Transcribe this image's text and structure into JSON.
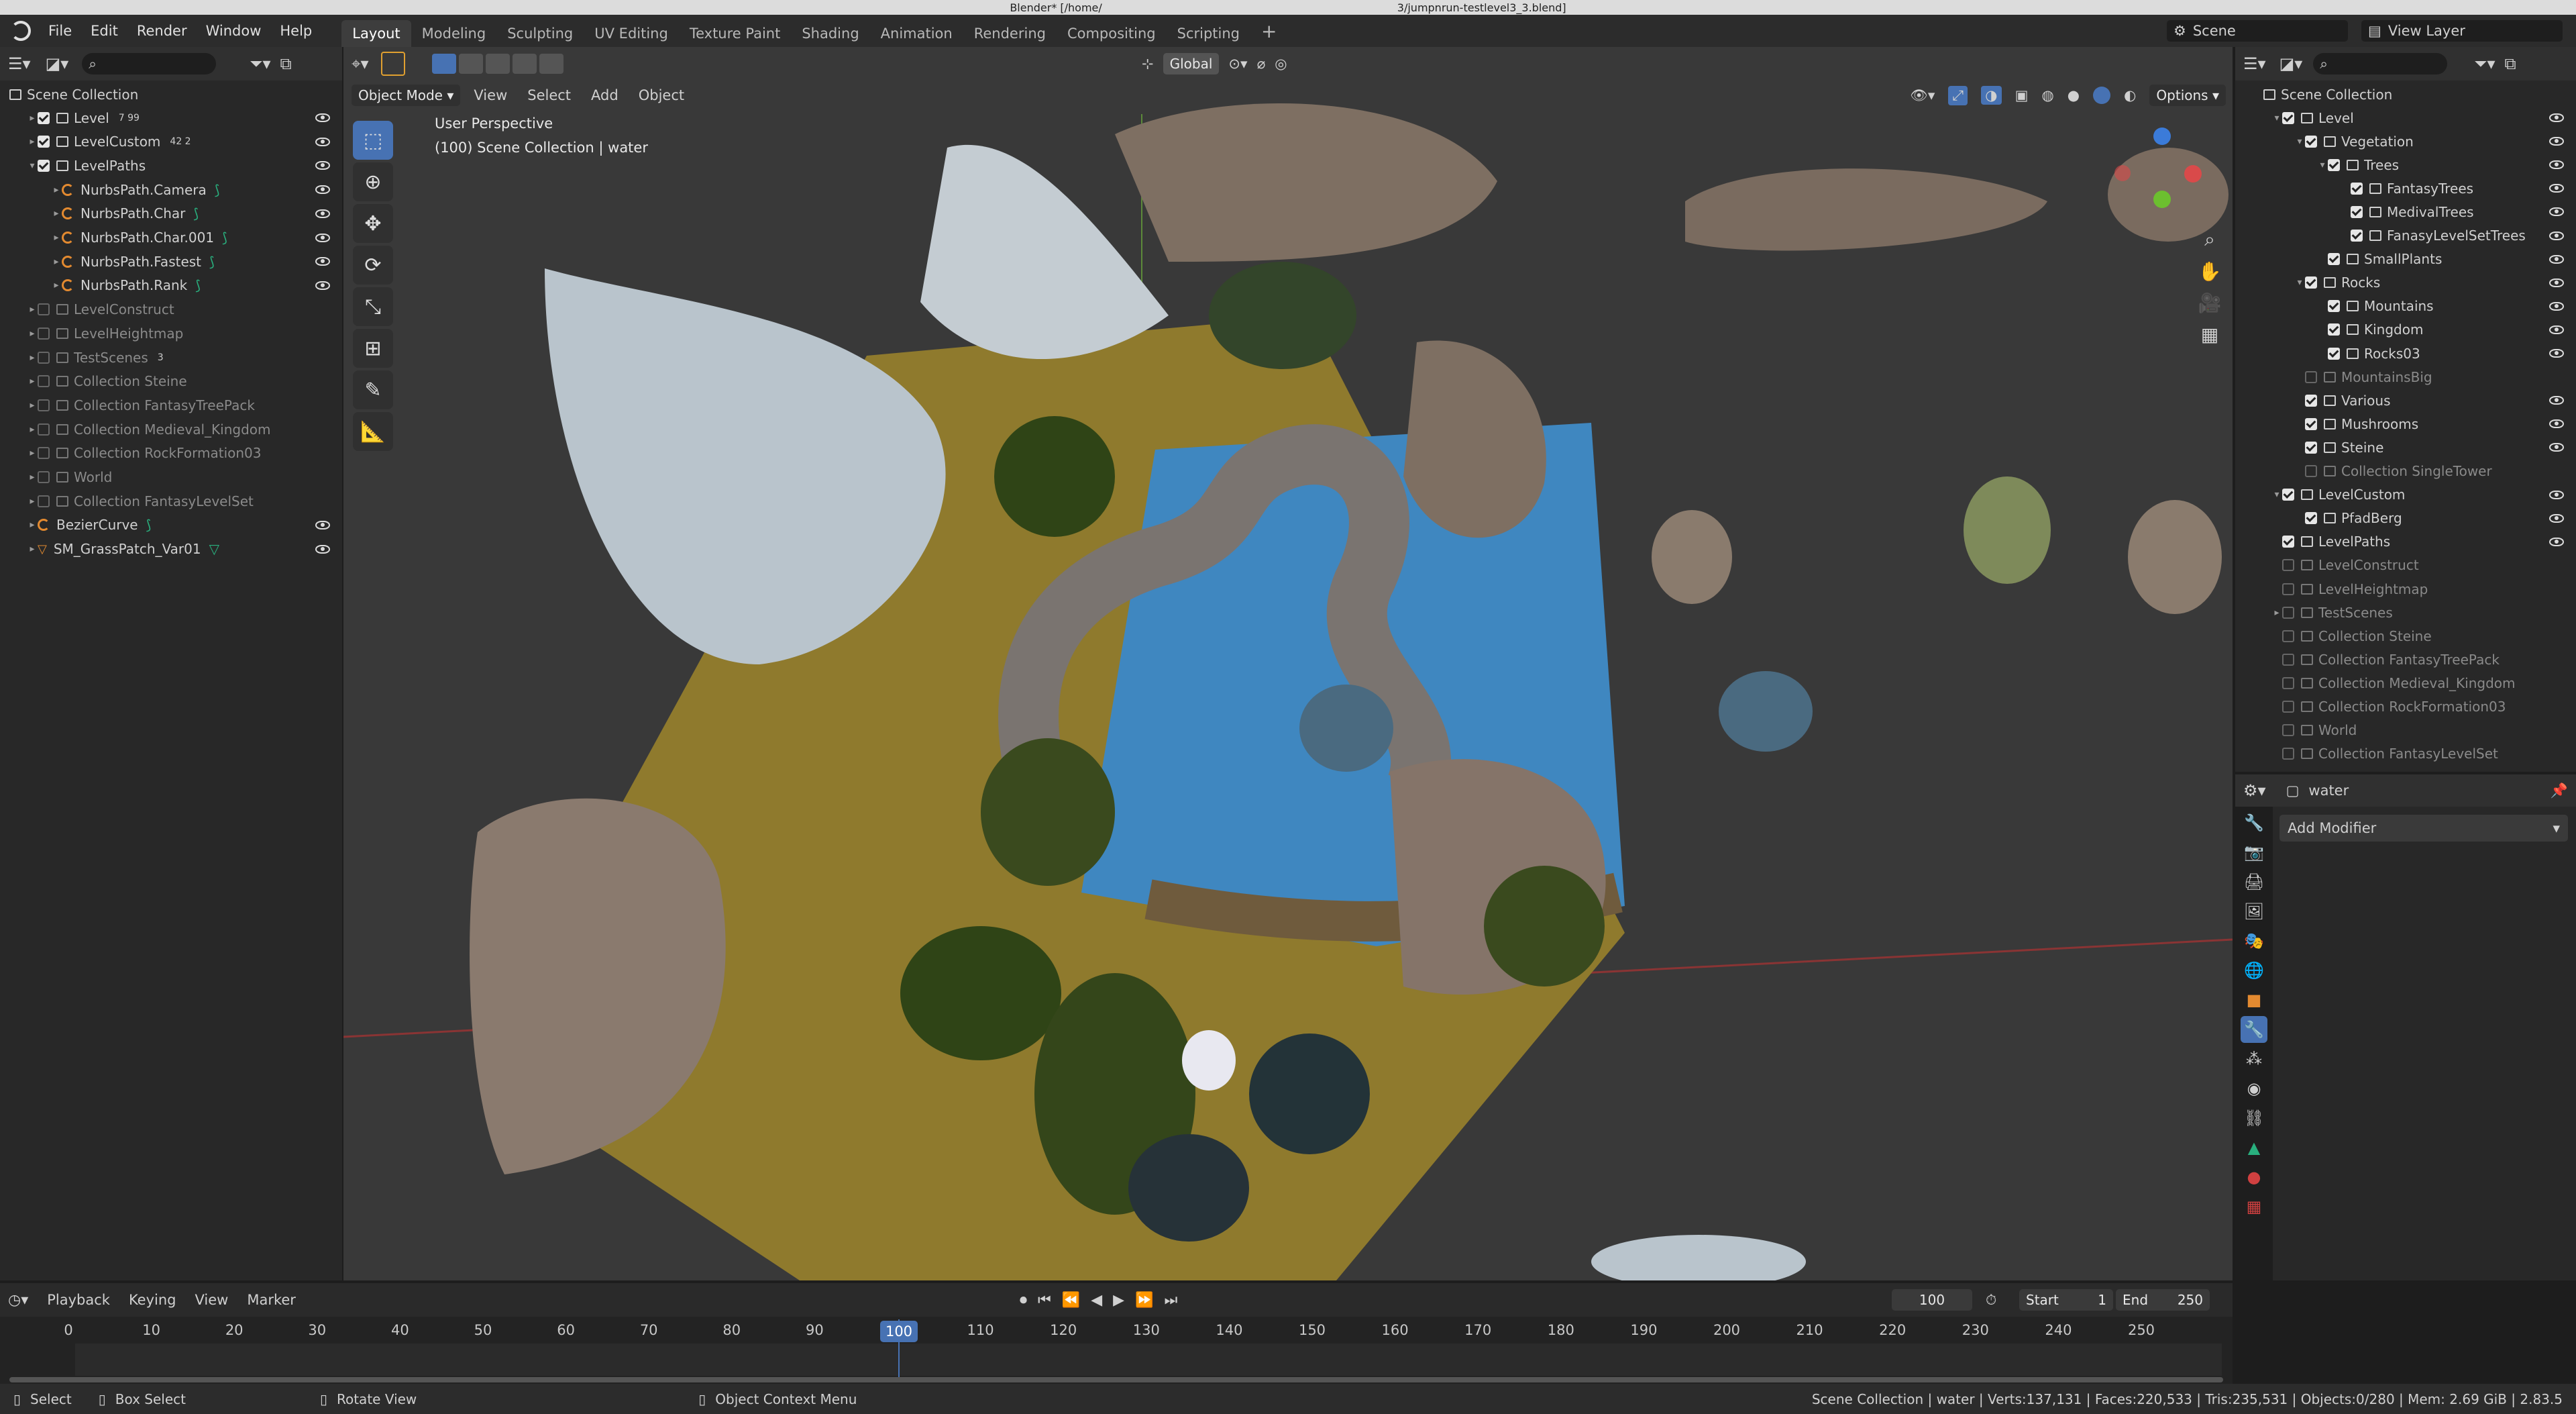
{
  "titlebar": {
    "left": "Blender* [/home/",
    "right": "3/jumpnrun-testlevel3_3.blend]"
  },
  "topbar": {
    "menus": [
      "File",
      "Edit",
      "Render",
      "Window",
      "Help"
    ],
    "workspaces": [
      "Layout",
      "Modeling",
      "Sculpting",
      "UV Editing",
      "Texture Paint",
      "Shading",
      "Animation",
      "Rendering",
      "Compositing",
      "Scripting"
    ],
    "add_tab": "+",
    "scene_label": "Scene",
    "view_layer_label": "View Layer"
  },
  "left_outliner": {
    "root": "Scene Collection",
    "rows": [
      {
        "label": "Level",
        "depth": 1,
        "checked": true,
        "dim": false,
        "type": "collection",
        "badge": "7 99"
      },
      {
        "label": "LevelCustom",
        "depth": 1,
        "checked": true,
        "dim": false,
        "type": "collection",
        "badge": "42 2"
      },
      {
        "label": "LevelPaths",
        "depth": 1,
        "checked": true,
        "dim": false,
        "type": "collection",
        "expanded": true
      },
      {
        "label": "NurbsPath.Camera",
        "depth": 2,
        "type": "curve"
      },
      {
        "label": "NurbsPath.Char",
        "depth": 2,
        "type": "curve"
      },
      {
        "label": "NurbsPath.Char.001",
        "depth": 2,
        "type": "curve"
      },
      {
        "label": "NurbsPath.Fastest",
        "depth": 2,
        "type": "curve"
      },
      {
        "label": "NurbsPath.Rank",
        "depth": 2,
        "type": "curve"
      },
      {
        "label": "LevelConstruct",
        "depth": 1,
        "checked": false,
        "dim": true,
        "type": "collection"
      },
      {
        "label": "LevelHeightmap",
        "depth": 1,
        "checked": false,
        "dim": true,
        "type": "collection"
      },
      {
        "label": "TestScenes",
        "depth": 1,
        "checked": false,
        "dim": true,
        "type": "collection",
        "badge": "3"
      },
      {
        "label": "Collection Steine",
        "depth": 1,
        "checked": false,
        "dim": true,
        "type": "collection"
      },
      {
        "label": "Collection FantasyTreePack",
        "depth": 1,
        "checked": false,
        "dim": true,
        "type": "collection"
      },
      {
        "label": "Collection Medieval_Kingdom",
        "depth": 1,
        "checked": false,
        "dim": true,
        "type": "collection"
      },
      {
        "label": "Collection RockFormation03",
        "depth": 1,
        "checked": false,
        "dim": true,
        "type": "collection"
      },
      {
        "label": "World",
        "depth": 1,
        "checked": false,
        "dim": true,
        "type": "collection"
      },
      {
        "label": "Collection FantasyLevelSet",
        "depth": 1,
        "checked": false,
        "dim": true,
        "type": "collection"
      },
      {
        "label": "BezierCurve",
        "depth": 1,
        "type": "curve"
      },
      {
        "label": "SM_GrassPatch_Var01",
        "depth": 1,
        "type": "mesh"
      }
    ]
  },
  "viewport": {
    "mode": "Object Mode",
    "menus": [
      "View",
      "Select",
      "Add",
      "Object"
    ],
    "transform_orientation": "Global",
    "options_label": "Options",
    "overlay_title": "User Perspective",
    "overlay_sub": "(100) Scene Collection | water"
  },
  "right_outliner": {
    "root": "Scene Collection",
    "rows": [
      {
        "label": "Level",
        "depth": 1,
        "checked": true
      },
      {
        "label": "Vegetation",
        "depth": 2,
        "checked": true
      },
      {
        "label": "Trees",
        "depth": 3,
        "checked": true
      },
      {
        "label": "FantasyTrees",
        "depth": 4,
        "checked": true
      },
      {
        "label": "MedivalTrees",
        "depth": 4,
        "checked": true
      },
      {
        "label": "FanasyLevelSetTrees",
        "depth": 4,
        "checked": true
      },
      {
        "label": "SmallPlants",
        "depth": 3,
        "checked": true
      },
      {
        "label": "Rocks",
        "depth": 2,
        "checked": true
      },
      {
        "label": "Mountains",
        "depth": 3,
        "checked": true
      },
      {
        "label": "Kingdom",
        "depth": 3,
        "checked": true
      },
      {
        "label": "Rocks03",
        "depth": 3,
        "checked": true
      },
      {
        "label": "MountainsBig",
        "depth": 2,
        "checked": false,
        "dim": true
      },
      {
        "label": "Various",
        "depth": 2,
        "checked": true
      },
      {
        "label": "Mushrooms",
        "depth": 2,
        "checked": true
      },
      {
        "label": "Steine",
        "depth": 2,
        "checked": true
      },
      {
        "label": "Collection SingleTower",
        "depth": 2,
        "checked": false,
        "dim": true
      },
      {
        "label": "LevelCustom",
        "depth": 1,
        "checked": true
      },
      {
        "label": "PfadBerg",
        "depth": 2,
        "checked": true
      },
      {
        "label": "LevelPaths",
        "depth": 1,
        "checked": true
      },
      {
        "label": "LevelConstruct",
        "depth": 1,
        "checked": false,
        "dim": true
      },
      {
        "label": "LevelHeightmap",
        "depth": 1,
        "checked": false,
        "dim": true
      },
      {
        "label": "TestScenes",
        "depth": 1,
        "checked": false,
        "dim": true
      },
      {
        "label": "Collection Steine",
        "depth": 1,
        "checked": false,
        "dim": true
      },
      {
        "label": "Collection FantasyTreePack",
        "depth": 1,
        "checked": false,
        "dim": true
      },
      {
        "label": "Collection Medieval_Kingdom",
        "depth": 1,
        "checked": false,
        "dim": true
      },
      {
        "label": "Collection RockFormation03",
        "depth": 1,
        "checked": false,
        "dim": true
      },
      {
        "label": "World",
        "depth": 1,
        "checked": false,
        "dim": true
      },
      {
        "label": "Collection FantasyLevelSet",
        "depth": 1,
        "checked": false,
        "dim": true
      }
    ]
  },
  "properties": {
    "object_name": "water",
    "add_modifier": "Add Modifier"
  },
  "timeline": {
    "menus": [
      "Playback",
      "Keying",
      "View",
      "Marker"
    ],
    "current_frame": "100",
    "start_label": "Start",
    "start": "1",
    "end_label": "End",
    "end": "250",
    "ticks": [
      "0",
      "10",
      "20",
      "30",
      "40",
      "50",
      "60",
      "70",
      "80",
      "90",
      "100",
      "110",
      "120",
      "130",
      "140",
      "150",
      "160",
      "170",
      "180",
      "190",
      "200",
      "210",
      "220",
      "230",
      "240",
      "250"
    ]
  },
  "statusbar": {
    "select": "Select",
    "box_select": "Box Select",
    "rotate": "Rotate View",
    "context_menu": "Object Context Menu",
    "info": "Scene Collection | water | Verts:137,131 | Faces:220,533 | Tris:235,531 | Objects:0/280 | Mem: 2.69 GiB | 2.83.5"
  },
  "colors": {
    "accent": "#4772b3",
    "frame_marker": "#4772b3",
    "curve_icon": "#e38a30",
    "constraint_green": "#29b07e"
  }
}
